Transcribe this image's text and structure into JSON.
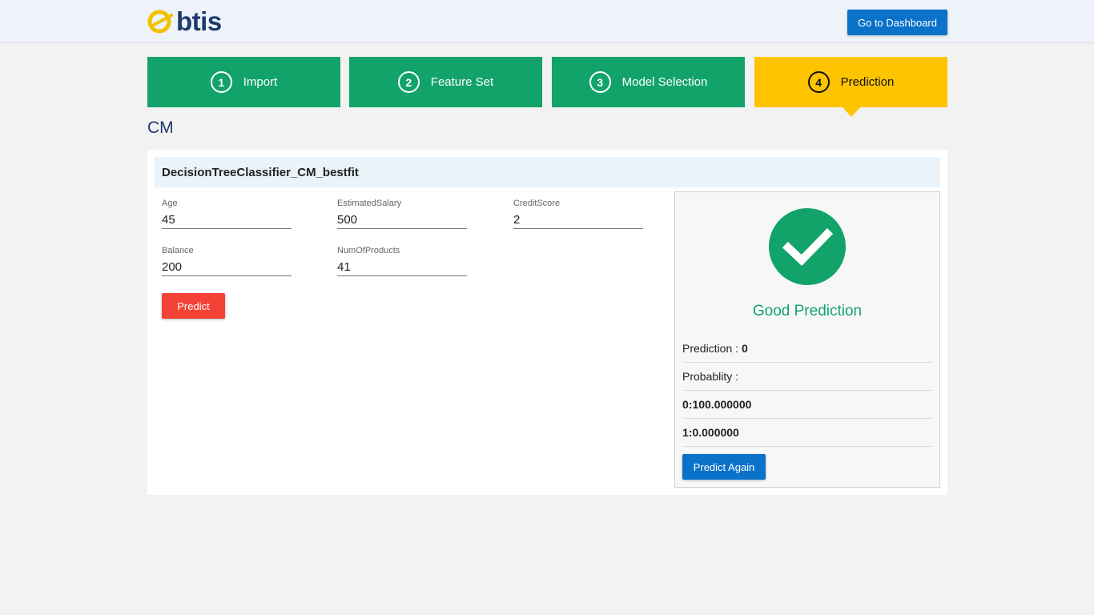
{
  "header": {
    "logo_text": "btis",
    "dashboard_label": "Go to Dashboard"
  },
  "steps": [
    {
      "number": "1",
      "label": "Import",
      "active": false
    },
    {
      "number": "2",
      "label": "Feature Set",
      "active": false
    },
    {
      "number": "3",
      "label": "Model Selection",
      "active": false
    },
    {
      "number": "4",
      "label": "Prediction",
      "active": true
    }
  ],
  "page_title": "CM",
  "model": {
    "name": "DecisionTreeClassifier_CM_bestfit"
  },
  "fields": {
    "age": {
      "label": "Age",
      "value": "45"
    },
    "estimated_salary": {
      "label": "EstimatedSalary",
      "value": "500"
    },
    "credit_score": {
      "label": "CreditScore",
      "value": "2"
    },
    "balance": {
      "label": "Balance",
      "value": "200"
    },
    "num_of_products": {
      "label": "NumOfProducts",
      "value": "41"
    }
  },
  "predict_label": "Predict",
  "result": {
    "status": "Good Prediction",
    "prediction_label": "Prediction :",
    "prediction_value": "0",
    "probability_label": "Probablity :",
    "prob_0": "0:100.000000",
    "prob_1": "1:0.000000",
    "predict_again_label": "Predict Again"
  },
  "colors": {
    "green": "#12a36a",
    "yellow": "#ffc400",
    "blue": "#0a72c9",
    "red": "#f44336",
    "navy": "#1d3a6b"
  }
}
